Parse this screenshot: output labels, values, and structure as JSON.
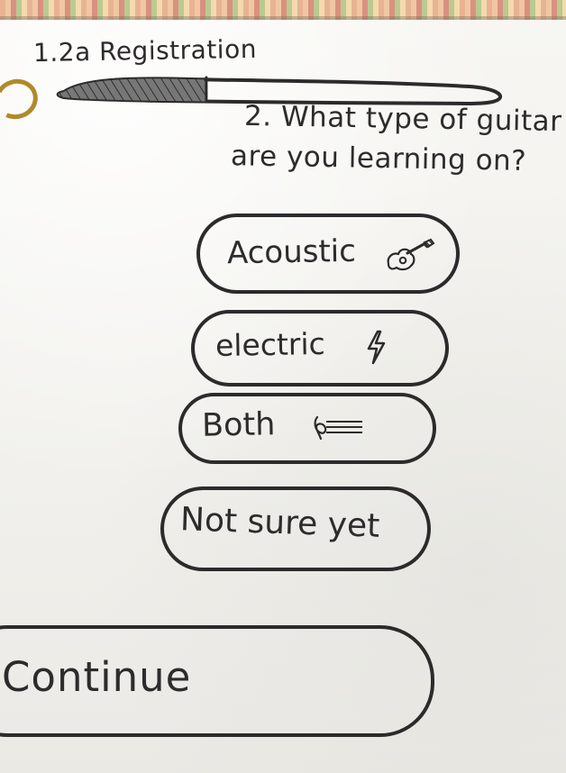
{
  "header": {
    "title": "1.2a Registration",
    "progress": 0.34
  },
  "question": {
    "line1": "2. What type of guitar",
    "line2": "are you learning on?"
  },
  "options": [
    {
      "label": "Acoustic",
      "icon": "guitar-icon"
    },
    {
      "label": "electric",
      "icon": "lightning-icon"
    },
    {
      "label": "Both",
      "icon": "music-note-icon"
    },
    {
      "label": "Not sure yet",
      "icon": ""
    }
  ],
  "continue": {
    "label": "Continue"
  },
  "colors": {
    "ink": "#2d2b2b",
    "paper": "#f2f1ee",
    "progress_fill": "#595959",
    "ring": "#b08a2a"
  }
}
